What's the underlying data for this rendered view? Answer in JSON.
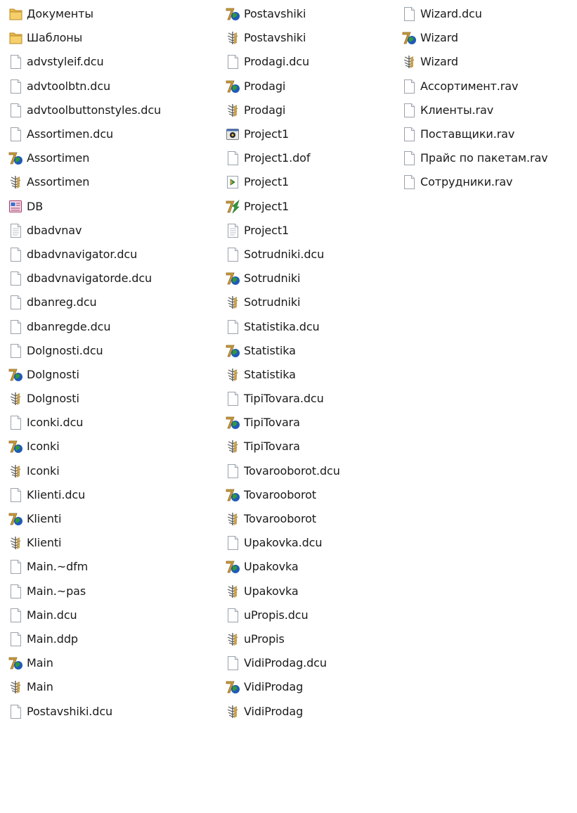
{
  "colors": {
    "folder": "#e8b84a",
    "file_border": "#9aa3ad",
    "delphi_tan": "#c89a3c",
    "delphi_green": "#2f9a3a",
    "delphi_blue": "#1f5ab8",
    "text": "#1a1a1a"
  },
  "columns": [
    [
      {
        "name": "Документы",
        "icon": "folder-icon"
      },
      {
        "name": "Шаблоны",
        "icon": "folder-icon"
      },
      {
        "name": "advstyleif.dcu",
        "icon": "file-icon"
      },
      {
        "name": "advtoolbtn.dcu",
        "icon": "file-icon"
      },
      {
        "name": "advtoolbuttonstyles.dcu",
        "icon": "file-icon"
      },
      {
        "name": "Assortimen.dcu",
        "icon": "file-icon"
      },
      {
        "name": "Assortimen",
        "icon": "delphi-unit-icon"
      },
      {
        "name": "Assortimen",
        "icon": "delphi-form-icon"
      },
      {
        "name": "DB",
        "icon": "database-icon"
      },
      {
        "name": "dbadvnav",
        "icon": "text-file-icon"
      },
      {
        "name": "dbadvnavigator.dcu",
        "icon": "file-icon"
      },
      {
        "name": "dbadvnavigatorde.dcu",
        "icon": "file-icon"
      },
      {
        "name": "dbanreg.dcu",
        "icon": "file-icon"
      },
      {
        "name": "dbanregde.dcu",
        "icon": "file-icon"
      },
      {
        "name": "Dolgnosti.dcu",
        "icon": "file-icon"
      },
      {
        "name": "Dolgnosti",
        "icon": "delphi-unit-icon"
      },
      {
        "name": "Dolgnosti",
        "icon": "delphi-form-icon"
      },
      {
        "name": "Iconki.dcu",
        "icon": "file-icon"
      },
      {
        "name": "Iconki",
        "icon": "delphi-unit-icon"
      },
      {
        "name": "Iconki",
        "icon": "delphi-form-icon"
      },
      {
        "name": "Klienti.dcu",
        "icon": "file-icon"
      },
      {
        "name": "Klienti",
        "icon": "delphi-unit-icon"
      },
      {
        "name": "Klienti",
        "icon": "delphi-form-icon"
      },
      {
        "name": "Main.~dfm",
        "icon": "file-icon"
      },
      {
        "name": "Main.~pas",
        "icon": "file-icon"
      },
      {
        "name": "Main.dcu",
        "icon": "file-icon"
      },
      {
        "name": "Main.ddp",
        "icon": "file-icon"
      },
      {
        "name": "Main",
        "icon": "delphi-unit-icon"
      },
      {
        "name": "Main",
        "icon": "delphi-form-icon"
      },
      {
        "name": "Postavshiki.dcu",
        "icon": "file-icon"
      }
    ],
    [
      {
        "name": "Postavshiki",
        "icon": "delphi-unit-icon"
      },
      {
        "name": "Postavshiki",
        "icon": "delphi-form-icon"
      },
      {
        "name": "Prodagi.dcu",
        "icon": "file-icon"
      },
      {
        "name": "Prodagi",
        "icon": "delphi-unit-icon"
      },
      {
        "name": "Prodagi",
        "icon": "delphi-form-icon"
      },
      {
        "name": "Project1",
        "icon": "exe-icon"
      },
      {
        "name": "Project1.dof",
        "icon": "file-icon"
      },
      {
        "name": "Project1",
        "icon": "resource-icon"
      },
      {
        "name": "Project1",
        "icon": "delphi-project-icon"
      },
      {
        "name": "Project1",
        "icon": "text-file-icon"
      },
      {
        "name": "Sotrudniki.dcu",
        "icon": "file-icon"
      },
      {
        "name": "Sotrudniki",
        "icon": "delphi-unit-icon"
      },
      {
        "name": "Sotrudniki",
        "icon": "delphi-form-icon"
      },
      {
        "name": "Statistika.dcu",
        "icon": "file-icon"
      },
      {
        "name": "Statistika",
        "icon": "delphi-unit-icon"
      },
      {
        "name": "Statistika",
        "icon": "delphi-form-icon"
      },
      {
        "name": "TipiTovara.dcu",
        "icon": "file-icon"
      },
      {
        "name": "TipiTovara",
        "icon": "delphi-unit-icon"
      },
      {
        "name": "TipiTovara",
        "icon": "delphi-form-icon"
      },
      {
        "name": "Tovarooborot.dcu",
        "icon": "file-icon"
      },
      {
        "name": "Tovarooborot",
        "icon": "delphi-unit-icon"
      },
      {
        "name": "Tovarooborot",
        "icon": "delphi-form-icon"
      },
      {
        "name": "Upakovka.dcu",
        "icon": "file-icon"
      },
      {
        "name": "Upakovka",
        "icon": "delphi-unit-icon"
      },
      {
        "name": "Upakovka",
        "icon": "delphi-form-icon"
      },
      {
        "name": "uPropis.dcu",
        "icon": "file-icon"
      },
      {
        "name": "uPropis",
        "icon": "delphi-form-icon"
      },
      {
        "name": "VidiProdag.dcu",
        "icon": "file-icon"
      },
      {
        "name": "VidiProdag",
        "icon": "delphi-unit-icon"
      },
      {
        "name": "VidiProdag",
        "icon": "delphi-form-icon"
      }
    ],
    [
      {
        "name": "Wizard.dcu",
        "icon": "file-icon"
      },
      {
        "name": "Wizard",
        "icon": "delphi-unit-icon"
      },
      {
        "name": "Wizard",
        "icon": "delphi-form-icon"
      },
      {
        "name": "Ассортимент.rav",
        "icon": "file-icon"
      },
      {
        "name": "Клиенты.rav",
        "icon": "file-icon"
      },
      {
        "name": "Поставщики.rav",
        "icon": "file-icon"
      },
      {
        "name": "Прайс по пакетам.rav",
        "icon": "file-icon"
      },
      {
        "name": "Сотрудники.rav",
        "icon": "file-icon"
      }
    ]
  ]
}
